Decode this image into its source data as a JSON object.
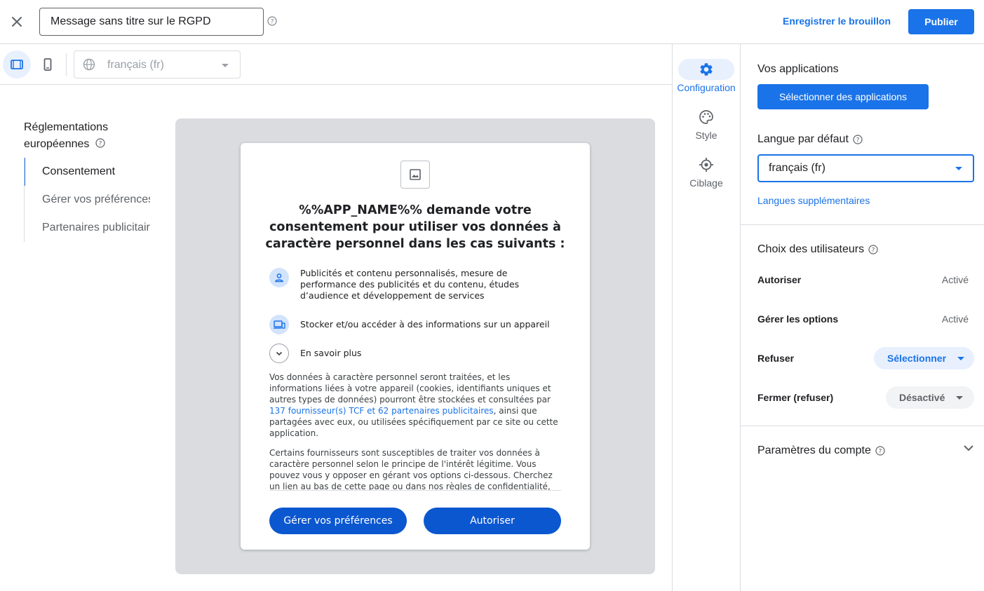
{
  "header": {
    "message_title": "Message sans titre sur le RGPD",
    "save_draft_label": "Enregistrer le brouillon",
    "publish_label": "Publier"
  },
  "toolbar": {
    "preview_language": "français (fr)"
  },
  "outline": {
    "title": "Réglementations européennes",
    "items": [
      {
        "label": "Consentement"
      },
      {
        "label": "Gérer vos préférences"
      },
      {
        "label": "Partenaires publicitaires"
      }
    ]
  },
  "dialog": {
    "title": "%%APP_NAME%% demande votre consentement pour utiliser vos données à caractère personnel dans les cas suivants :",
    "purposes": [
      {
        "icon": "person-icon",
        "text": "Publicités et contenu personnalisés, mesure de performance des publicités et du contenu, études d’audience et développement de services"
      },
      {
        "icon": "devices-icon",
        "text": "Stocker et/ou accéder à des informations sur un appareil"
      },
      {
        "icon": "expand-icon",
        "text": "En savoir plus"
      }
    ],
    "para1_before": "Vos données à caractère personnel seront traitées, et les informations liées à votre appareil (cookies, identifiants uniques et autres types de données) pourront être stockées et consultées par ",
    "para1_link": "137 fournisseur(s) TCF et 62 partenaires publicitaires",
    "para1_after": ", ainsi que partagées avec eux, ou utilisées spécifiquement par ce site ou cette application.",
    "para2": "Certains fournisseurs sont susceptibles de traiter vos données à caractère personnel selon le principe de l'intérêt légitime. Vous pouvez vous y opposer en gérant vos options ci-dessous. Cherchez un lien au bas de cette page ou dans nos règles de confidentialité, vous pourrez y retirer votre consentement.",
    "manage_label": "Gérer vos préférences",
    "allow_label": "Autoriser"
  },
  "vtabs": [
    {
      "label": "Configuration",
      "icon": "gear-icon",
      "active": true
    },
    {
      "label": "Style",
      "icon": "palette-icon",
      "active": false
    },
    {
      "label": "Ciblage",
      "icon": "target-icon",
      "active": false
    }
  ],
  "panel": {
    "apps_heading": "Vos applications",
    "select_apps_label": "Sélectionner des applications",
    "default_lang_heading": "Langue par défaut",
    "default_lang_value": "français (fr)",
    "more_langs_label": "Langues supplémentaires",
    "choices_heading": "Choix des utilisateurs",
    "choices": [
      {
        "name": "Autoriser",
        "value": "Activé"
      },
      {
        "name": "Gérer les options",
        "value": "Activé"
      },
      {
        "name": "Refuser",
        "value": "Sélectionner"
      },
      {
        "name": "Fermer (refuser)",
        "value": "Désactivé"
      }
    ],
    "account_heading": "Paramètres du compte"
  },
  "colors": {
    "accent": "#1a73e8",
    "dialog_button": "#0b57d0",
    "preview_bg": "#dadce0"
  }
}
